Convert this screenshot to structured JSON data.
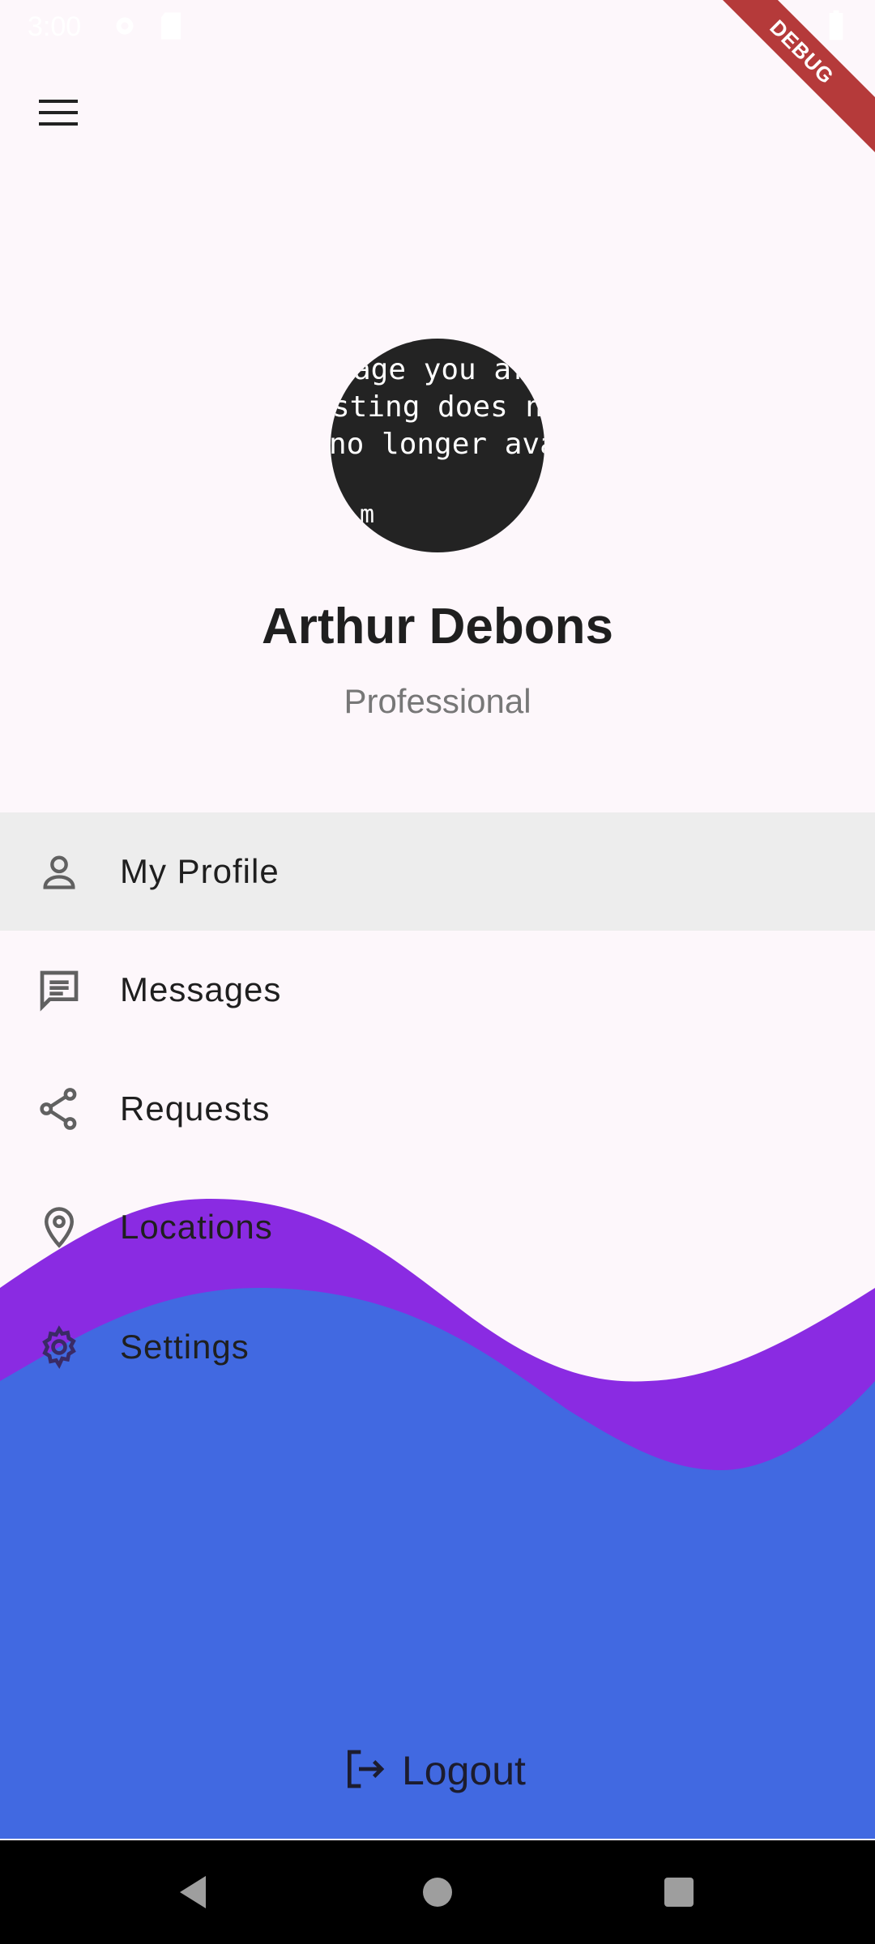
{
  "status_bar": {
    "time": "3:00",
    "icons": [
      "settings-icon",
      "sd-card-icon",
      "wifi-icon",
      "battery-icon"
    ]
  },
  "debug_banner": {
    "label": "DEBUG"
  },
  "header": {
    "menu_icon": "hamburger-menu-icon"
  },
  "profile": {
    "avatar_placeholder_lines": [
      "age you are",
      "sting does no",
      "no longer avail",
      "m"
    ],
    "name": "Arthur Debons",
    "role": "Professional"
  },
  "menu": {
    "items": [
      {
        "label": "My Profile",
        "icon": "person-icon",
        "selected": true
      },
      {
        "label": "Messages",
        "icon": "message-icon",
        "selected": false
      },
      {
        "label": "Requests",
        "icon": "share-icon",
        "selected": false
      },
      {
        "label": "Locations",
        "icon": "location-pin-icon",
        "selected": false
      },
      {
        "label": "Settings",
        "icon": "settings-gear-icon",
        "selected": false
      }
    ]
  },
  "logout": {
    "label": "Logout",
    "icon": "logout-icon"
  },
  "colors": {
    "background": "#fdf7fb",
    "selected_row": "#ededed",
    "wave_purple": "#8a2be2",
    "wave_blue": "#4169e1",
    "debug_ribbon": "#b53a3a"
  },
  "system_nav": {
    "buttons": [
      "back-icon",
      "home-icon",
      "recents-icon"
    ]
  }
}
